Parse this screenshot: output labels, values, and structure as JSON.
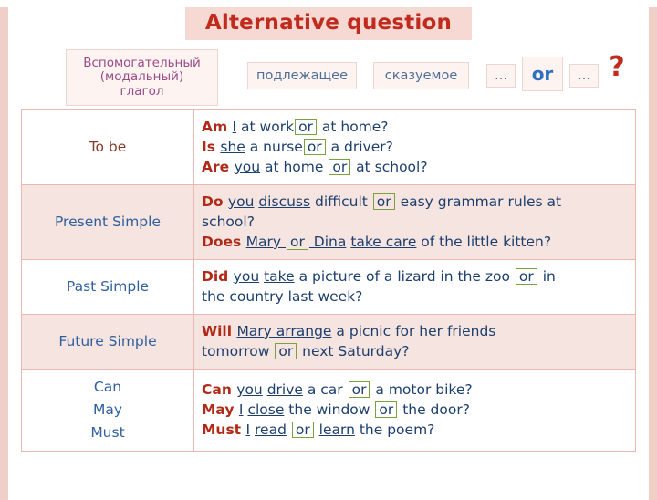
{
  "title": "Alternative question",
  "header": {
    "aux_line1": "Вспомогательный",
    "aux_line2": "(модальный)",
    "aux_line3": "глагол",
    "subject": "подлежащее",
    "predicate": "сказуемое",
    "dots_left": "…",
    "or": "or",
    "dots_right": "…",
    "question_mark": "?"
  },
  "colors": {
    "title_text": "#c02b1e",
    "title_bg": "#f7d9d3",
    "page_border": "#f0cfc8",
    "row_tint": "#f6e4e0",
    "label_blue": "#2f5f9e",
    "aux_purple": "#9a4b86",
    "or_blue": "#2f6fc0",
    "box_green": "#7aa23c",
    "red": "#b02a18"
  },
  "rows": [
    {
      "label": "To be",
      "lines": [
        [
          {
            "t": "Am ",
            "s": "red"
          },
          {
            "t": "I",
            "s": "u"
          },
          {
            "t": " at work",
            "s": "plain"
          },
          {
            "t": "or",
            "s": "boxed"
          },
          {
            "t": " at home?",
            "s": "plain"
          }
        ],
        [
          {
            "t": "Is ",
            "s": "red"
          },
          {
            "t": "she",
            "s": "u"
          },
          {
            "t": " a nurse",
            "s": "plain"
          },
          {
            "t": "or",
            "s": "boxed"
          },
          {
            "t": " a driver?",
            "s": "plain"
          }
        ],
        [
          {
            "t": "Are ",
            "s": "red"
          },
          {
            "t": "you",
            "s": "u"
          },
          {
            "t": " at home ",
            "s": "plain"
          },
          {
            "t": "or",
            "s": "boxed"
          },
          {
            "t": " at school?",
            "s": "plain"
          }
        ]
      ]
    },
    {
      "label": "Present Simple",
      "lines": [
        [
          {
            "t": "Do ",
            "s": "red"
          },
          {
            "t": "you",
            "s": "u"
          },
          {
            "t": " ",
            "s": "plain"
          },
          {
            "t": "discuss",
            "s": "u"
          },
          {
            "t": " difficult ",
            "s": "plain"
          },
          {
            "t": "or",
            "s": "boxed"
          },
          {
            "t": " easy grammar rules at",
            "s": "plain"
          }
        ],
        [
          {
            "t": "school?",
            "s": "plain"
          }
        ],
        [
          {
            "t": "Does ",
            "s": "red"
          },
          {
            "t": "Mary ",
            "s": "u"
          },
          {
            "t": "or",
            "s": "boxed"
          },
          {
            "t": " Dina",
            "s": "u"
          },
          {
            "t": " ",
            "s": "plain"
          },
          {
            "t": "take care",
            "s": "u"
          },
          {
            "t": " of the little kitten?",
            "s": "plain"
          }
        ]
      ]
    },
    {
      "label": "Past Simple",
      "lines": [
        [
          {
            "t": "Did ",
            "s": "red"
          },
          {
            "t": "you",
            "s": "u"
          },
          {
            "t": " ",
            "s": "plain"
          },
          {
            "t": "take",
            "s": "u"
          },
          {
            "t": " a picture of a lizard in the zoo ",
            "s": "plain"
          },
          {
            "t": "or",
            "s": "boxed"
          },
          {
            "t": " in",
            "s": "plain"
          }
        ],
        [
          {
            "t": "the country last week?",
            "s": "plain"
          }
        ]
      ]
    },
    {
      "label": "Future Simple",
      "lines": [
        [
          {
            "t": "Will ",
            "s": "red"
          },
          {
            "t": "Mary ",
            "s": "u"
          },
          {
            "t": "arrange",
            "s": "u"
          },
          {
            "t": " a picnic for her friends",
            "s": "plain"
          }
        ],
        [
          {
            "t": "tomorrow ",
            "s": "plain"
          },
          {
            "t": "or",
            "s": "boxed"
          },
          {
            "t": " next Saturday?",
            "s": "plain"
          }
        ]
      ]
    },
    {
      "label": "Can\nMay\nMust",
      "label_lines": [
        "Can",
        "May",
        "Must"
      ],
      "lines": [
        [
          {
            "t": "Can ",
            "s": "red"
          },
          {
            "t": "you",
            "s": "u"
          },
          {
            "t": " ",
            "s": "plain"
          },
          {
            "t": "drive",
            "s": "u"
          },
          {
            "t": " a car ",
            "s": "plain"
          },
          {
            "t": "or",
            "s": "boxed"
          },
          {
            "t": " a motor bike?",
            "s": "plain"
          }
        ],
        [
          {
            "t": "May ",
            "s": "red"
          },
          {
            "t": "I",
            "s": "u"
          },
          {
            "t": " ",
            "s": "plain"
          },
          {
            "t": "close",
            "s": "u"
          },
          {
            "t": " the window ",
            "s": "plain"
          },
          {
            "t": "or",
            "s": "boxed"
          },
          {
            "t": " the door?",
            "s": "plain"
          }
        ],
        [
          {
            "t": "Must ",
            "s": "red"
          },
          {
            "t": "I",
            "s": "u"
          },
          {
            "t": " ",
            "s": "plain"
          },
          {
            "t": "read",
            "s": "u"
          },
          {
            "t": " ",
            "s": "plain"
          },
          {
            "t": "or",
            "s": "boxed"
          },
          {
            "t": " ",
            "s": "plain"
          },
          {
            "t": "learn",
            "s": "u"
          },
          {
            "t": " the poem?",
            "s": "plain"
          }
        ]
      ]
    }
  ]
}
